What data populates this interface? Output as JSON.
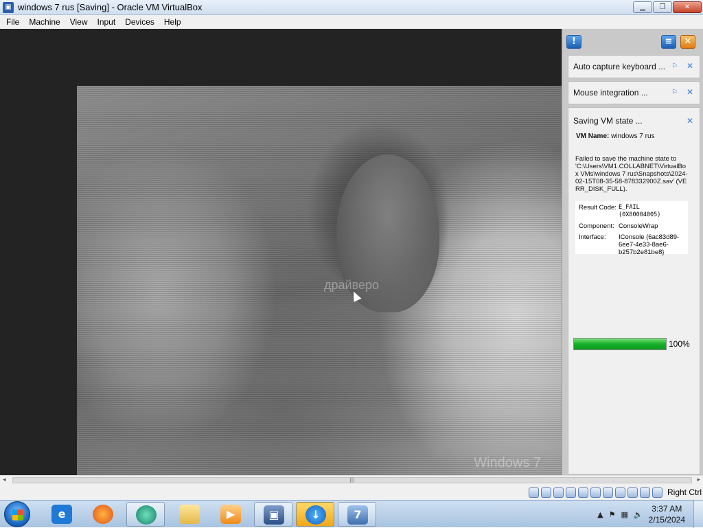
{
  "window": {
    "title": "windows 7 rus [Saving] - Oracle VM VirtualBox"
  },
  "menu": [
    "File",
    "Machine",
    "View",
    "Input",
    "Devices",
    "Help"
  ],
  "guest": {
    "watermark": "драйверо",
    "brand": "Windows 7"
  },
  "notifications": {
    "keyboard": {
      "title": "Auto capture keyboard ..."
    },
    "mouse": {
      "title": "Mouse integration ..."
    },
    "saving": {
      "title": "Saving VM state ...",
      "vm_name_label": "VM Name:",
      "vm_name": "windows 7 rus",
      "message": "Failed to save the machine state to 'C:\\Users\\VM1.COLLABNET\\VirtualBox VMs\\windows 7 rus\\Snapshots\\2024-02-15T08-35-58-878332900Z.sav' (VERR_DISK_FULL).",
      "result_code_label": "Result Code:",
      "result_code": "E_FAIL (0X80004005)",
      "component_label": "Component:",
      "component": "ConsoleWrap",
      "interface_label": "Interface:",
      "interface": "IConsole {6ac83d89-6ee7-4e33-8ae6-b257b2e81be8}",
      "progress": 1.0,
      "progress_text": "100%"
    }
  },
  "statusbar": {
    "host_key": "Right Ctrl"
  },
  "tray": {
    "time": "3:37 AM",
    "date": "2/15/2024"
  }
}
